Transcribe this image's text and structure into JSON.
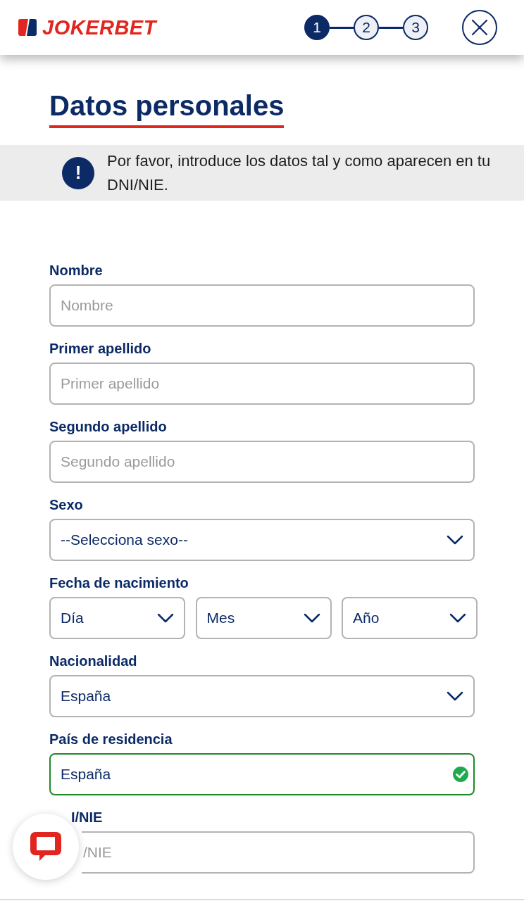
{
  "header": {
    "logo": "JOKERBET",
    "steps": [
      {
        "label": "1",
        "selected": true
      },
      {
        "label": "2",
        "selected": false
      },
      {
        "label": "3",
        "selected": false
      }
    ]
  },
  "title": "Datos personales",
  "notice": {
    "icon": "!",
    "text": "Por favor, introduce los datos tal y como aparecen en tu DNI/NIE."
  },
  "fields": [
    {
      "kind": "text",
      "label": "Nombre",
      "placeholder": "Nombre"
    },
    {
      "kind": "text",
      "label": "Primer apellido",
      "placeholder": "Primer apellido"
    },
    {
      "kind": "text",
      "label": "Segundo apellido",
      "placeholder": "Segundo apellido"
    },
    {
      "kind": "select",
      "label": "Sexo",
      "value": "--Selecciona sexo--"
    },
    {
      "kind": "date",
      "label": "Fecha de nacimiento",
      "parts": [
        "Día",
        "Mes",
        "Año"
      ]
    },
    {
      "kind": "select",
      "label": "Nacionalidad",
      "value": "España"
    },
    {
      "kind": "text",
      "label": "País de residencia",
      "value": "España",
      "valid": true
    },
    {
      "kind": "covered-text",
      "label": "I/NIE",
      "placeholder": "/NIE"
    }
  ]
}
